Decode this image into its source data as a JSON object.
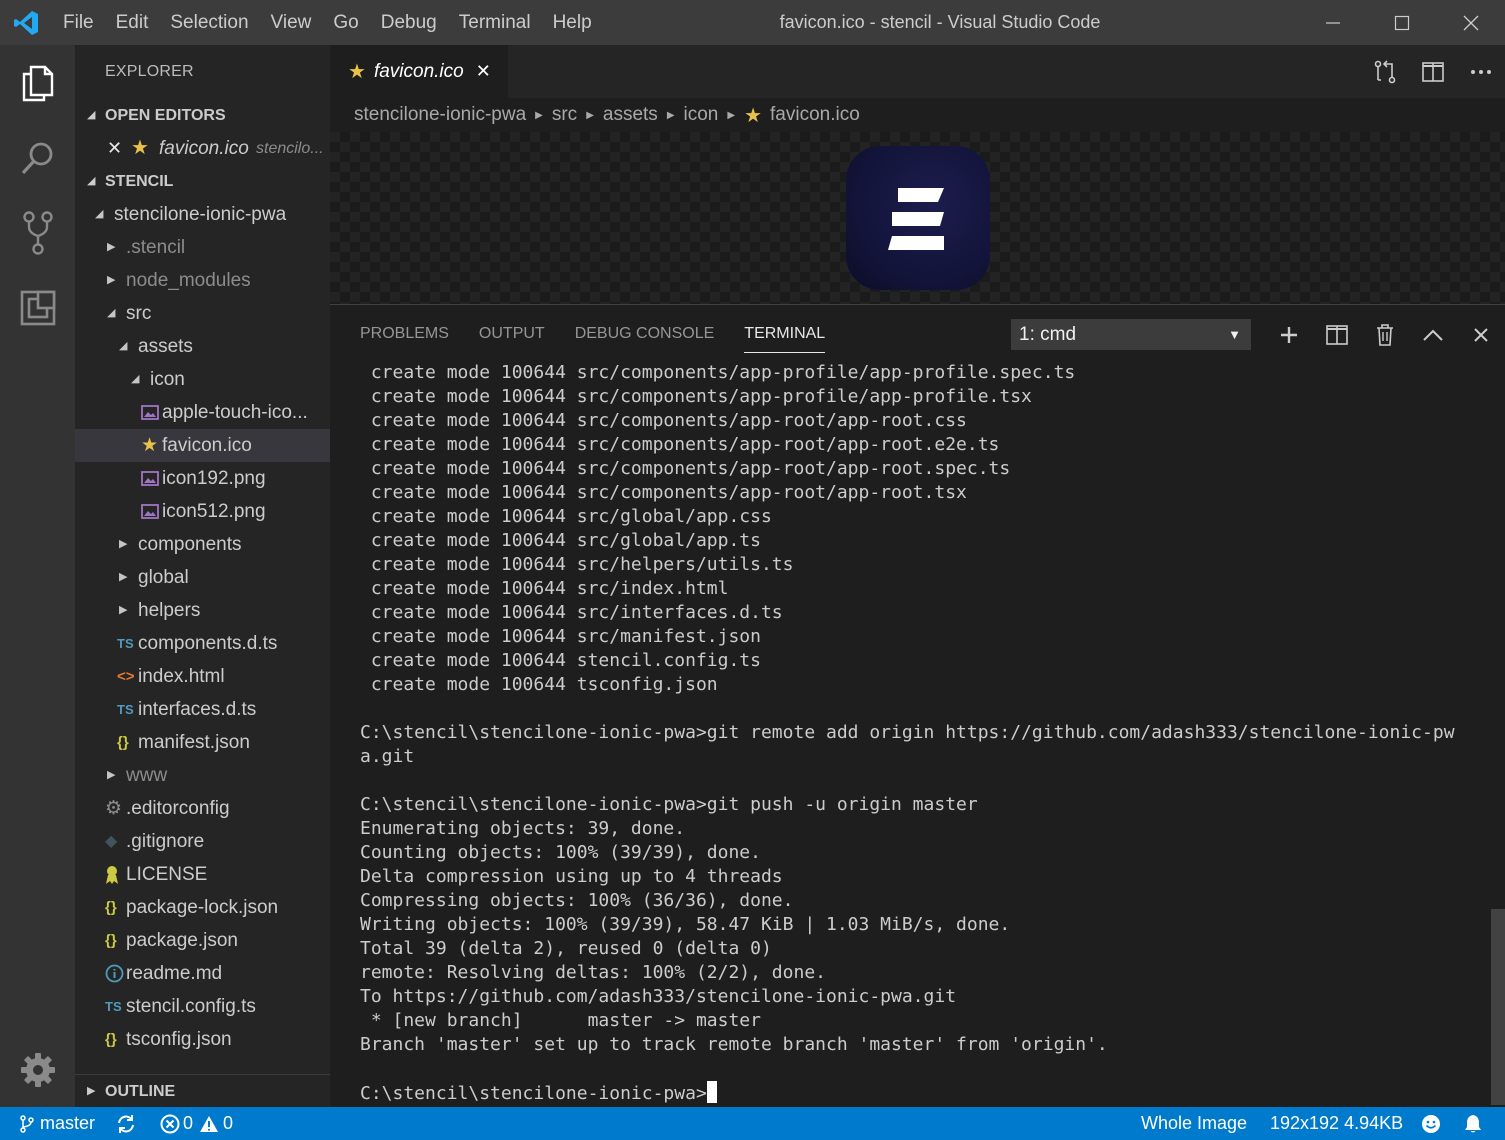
{
  "titlebar": {
    "menu": [
      "File",
      "Edit",
      "Selection",
      "View",
      "Go",
      "Debug",
      "Terminal",
      "Help"
    ],
    "title": "favicon.ico - stencil - Visual Studio Code"
  },
  "activitybar": {
    "icons": [
      "files-icon",
      "search-icon",
      "source-control-icon",
      "extensions-icon",
      "settings-gear-icon"
    ]
  },
  "sidebar": {
    "title": "EXPLORER",
    "open_editors": {
      "header": "OPEN EDITORS",
      "items": [
        {
          "name": "favicon.ico",
          "path": "stencilo..."
        }
      ]
    },
    "workspace": {
      "header": "STENCIL",
      "tree": [
        {
          "label": "stencilone-ionic-pwa",
          "kind": "folder-open",
          "level": 1
        },
        {
          "label": ".stencil",
          "kind": "folder",
          "level": 2,
          "dim": true
        },
        {
          "label": "node_modules",
          "kind": "folder",
          "level": 2,
          "dim": true
        },
        {
          "label": "src",
          "kind": "folder-open",
          "level": 2
        },
        {
          "label": "assets",
          "kind": "folder-open",
          "level": 3
        },
        {
          "label": "icon",
          "kind": "folder-open",
          "level": 4
        },
        {
          "label": "apple-touch-ico...",
          "kind": "image",
          "level": 5
        },
        {
          "label": "favicon.ico",
          "kind": "star",
          "level": 5,
          "selected": true
        },
        {
          "label": "icon192.png",
          "kind": "image",
          "level": 5
        },
        {
          "label": "icon512.png",
          "kind": "image",
          "level": 5
        },
        {
          "label": "components",
          "kind": "folder",
          "level": 3
        },
        {
          "label": "global",
          "kind": "folder",
          "level": 3
        },
        {
          "label": "helpers",
          "kind": "folder",
          "level": 3
        },
        {
          "label": "components.d.ts",
          "kind": "ts",
          "level": 3
        },
        {
          "label": "index.html",
          "kind": "html",
          "level": 3
        },
        {
          "label": "interfaces.d.ts",
          "kind": "ts",
          "level": 3
        },
        {
          "label": "manifest.json",
          "kind": "json",
          "level": 3
        },
        {
          "label": "www",
          "kind": "folder",
          "level": 2,
          "dim": true
        },
        {
          "label": ".editorconfig",
          "kind": "gear",
          "level": 2
        },
        {
          "label": ".gitignore",
          "kind": "git",
          "level": 2
        },
        {
          "label": "LICENSE",
          "kind": "license",
          "level": 2
        },
        {
          "label": "package-lock.json",
          "kind": "json",
          "level": 2
        },
        {
          "label": "package.json",
          "kind": "json",
          "level": 2
        },
        {
          "label": "readme.md",
          "kind": "info",
          "level": 2
        },
        {
          "label": "stencil.config.ts",
          "kind": "ts",
          "level": 2
        },
        {
          "label": "tsconfig.json",
          "kind": "json",
          "level": 2
        }
      ]
    },
    "outline": "OUTLINE"
  },
  "editor": {
    "tab_label": "favicon.ico",
    "breadcrumb": [
      "stencilone-ionic-pwa",
      "src",
      "assets",
      "icon",
      "favicon.ico"
    ]
  },
  "panel": {
    "tabs": [
      "PROBLEMS",
      "OUTPUT",
      "DEBUG CONSOLE",
      "TERMINAL"
    ],
    "active_tab": "TERMINAL",
    "terminal_select": "1: cmd",
    "lines": [
      " create mode 100644 src/components/app-profile/app-profile.spec.ts",
      " create mode 100644 src/components/app-profile/app-profile.tsx",
      " create mode 100644 src/components/app-root/app-root.css",
      " create mode 100644 src/components/app-root/app-root.e2e.ts",
      " create mode 100644 src/components/app-root/app-root.spec.ts",
      " create mode 100644 src/components/app-root/app-root.tsx",
      " create mode 100644 src/global/app.css",
      " create mode 100644 src/global/app.ts",
      " create mode 100644 src/helpers/utils.ts",
      " create mode 100644 src/index.html",
      " create mode 100644 src/interfaces.d.ts",
      " create mode 100644 src/manifest.json",
      " create mode 100644 stencil.config.ts",
      " create mode 100644 tsconfig.json",
      "",
      "C:\\stencil\\stencilone-ionic-pwa>git remote add origin https://github.com/adash333/stencilone-ionic-pw",
      "a.git",
      "",
      "C:\\stencil\\stencilone-ionic-pwa>git push -u origin master",
      "Enumerating objects: 39, done.",
      "Counting objects: 100% (39/39), done.",
      "Delta compression using up to 4 threads",
      "Compressing objects: 100% (36/36), done.",
      "Writing objects: 100% (39/39), 58.47 KiB | 1.03 MiB/s, done.",
      "Total 39 (delta 2), reused 0 (delta 0)",
      "remote: Resolving deltas: 100% (2/2), done.",
      "To https://github.com/adash333/stencilone-ionic-pwa.git",
      " * [new branch]      master -> master",
      "Branch 'master' set up to track remote branch 'master' from 'origin'.",
      ""
    ],
    "prompt": "C:\\stencil\\stencilone-ionic-pwa>"
  },
  "statusbar": {
    "branch": "master",
    "errors": "0",
    "warnings": "0",
    "image_type": "Whole Image",
    "image_info": "192x192 4.94KB"
  },
  "colors": {
    "statusbar": "#007acc",
    "titlebar": "#3c3c3c",
    "activitybar": "#333333",
    "sidebar": "#252526",
    "editor": "#1e1e1e",
    "star": "#e8c34a",
    "ts": "#519aba",
    "json": "#cbcb41",
    "html": "#e37933",
    "image": "#a074c4"
  }
}
